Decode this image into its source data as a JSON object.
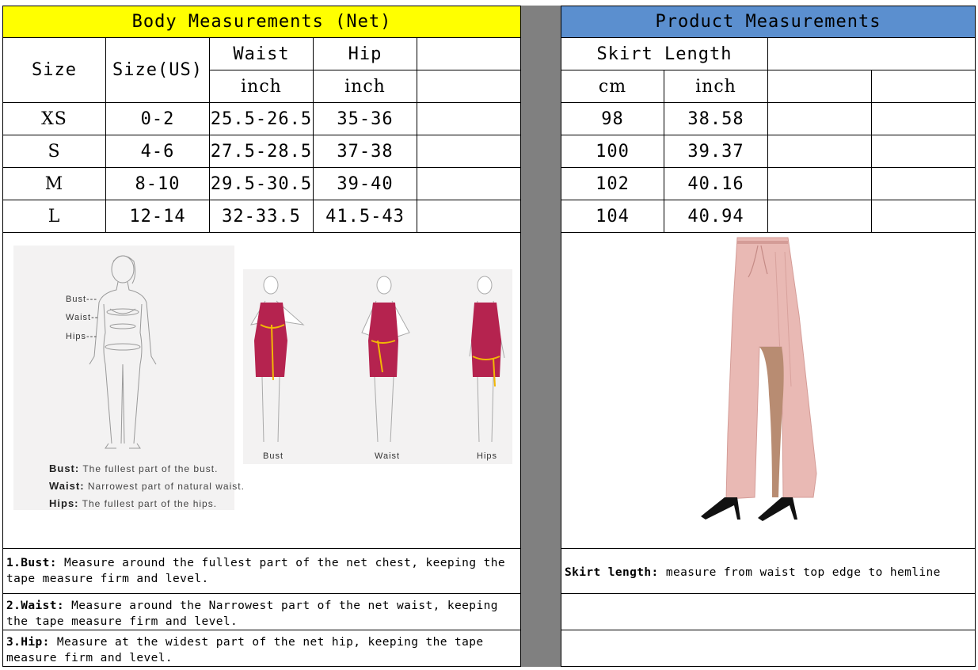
{
  "body_header": "Body Measurements (Net)",
  "product_header": "Product Measurements",
  "columns": {
    "size": "Size",
    "size_us": "Size(US)",
    "waist": "Waist",
    "hip": "Hip",
    "waist_unit": "inch",
    "hip_unit": "inch",
    "skirt_length": "Skirt Length",
    "cm": "cm",
    "inch": "inch"
  },
  "rows": [
    {
      "size": "XS",
      "us": "0-2",
      "waist": "25.5-26.5",
      "hip": "35-36",
      "cm": "98",
      "inch": "38.58"
    },
    {
      "size": "S",
      "us": "4-6",
      "waist": "27.5-28.5",
      "hip": "37-38",
      "cm": "100",
      "inch": "39.37"
    },
    {
      "size": "M",
      "us": "8-10",
      "waist": "29.5-30.5",
      "hip": "39-40",
      "cm": "102",
      "inch": "40.16"
    },
    {
      "size": "L",
      "us": "12-14",
      "waist": "32-33.5",
      "hip": "41.5-43",
      "cm": "104",
      "inch": "40.94"
    }
  ],
  "figure_labels": {
    "bust": "Bust---",
    "waist": "Waist--",
    "hips": "Hips---",
    "legend_bust_term": "Bust:",
    "legend_bust_desc": "The fullest part of the bust.",
    "legend_waist_term": "Waist:",
    "legend_waist_desc": "Narrowest part of natural waist.",
    "legend_hips_term": "Hips:",
    "legend_hips_desc": "The fullest part of the hips.",
    "dress_bust": "Bust",
    "dress_waist": "Waist",
    "dress_hips": "Hips"
  },
  "notes": {
    "bust_term": "1.Bust:",
    "bust_text": " Measure around the fullest part of the net chest, keeping the tape  measure firm and level.",
    "waist_term": "2.Waist:",
    "waist_text": " Measure around the Narrowest part of the net waist, keeping the tape  measure firm and level.",
    "hip_term": "3.Hip:",
    "hip_text": " Measure at the widest part of the net hip, keeping the tape measure firm and level.",
    "skirt_term": "Skirt length:",
    "skirt_text": " measure from waist top edge to hemline"
  },
  "colors": {
    "header_yellow": "#ffff00",
    "header_blue": "#5b8fcf",
    "separator_gray": "#808080",
    "dress": "#b5234f",
    "tape": "#f2b705",
    "skirt": "#e9b9b4"
  }
}
